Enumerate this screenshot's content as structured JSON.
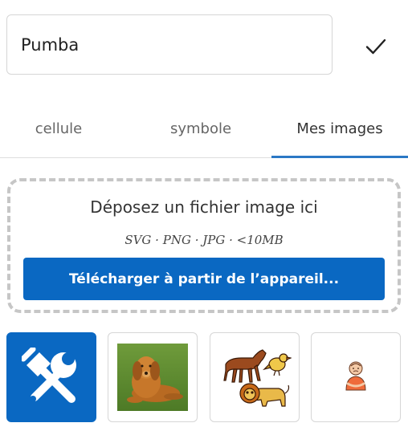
{
  "name_input": {
    "value": "Pumba"
  },
  "confirm": {
    "icon": "checkmark-icon"
  },
  "tabs": [
    {
      "label": "cellule",
      "active": false
    },
    {
      "label": "symbole",
      "active": false
    },
    {
      "label": "Mes images",
      "active": true
    }
  ],
  "dropzone": {
    "title": "Déposez un fichier image ici",
    "formats": "SVG · PNG · JPG · <10MB",
    "upload_label": "Télécharger à partir de l’appareil..."
  },
  "images": [
    {
      "icon": "tools-icon",
      "selected": true
    },
    {
      "icon": "dog-photo",
      "selected": false
    },
    {
      "icon": "animals-drawing",
      "selected": false
    },
    {
      "icon": "person-drawing",
      "selected": false
    }
  ],
  "colors": {
    "accent": "#0a68c2",
    "tab_underline": "#2b78c5",
    "border": "#d6d6d6",
    "dropzone_border": "#c6c6c6"
  }
}
